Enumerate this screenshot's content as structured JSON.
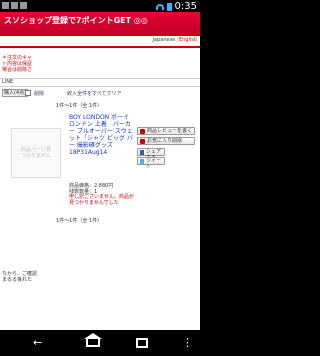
{
  "status_bar": {
    "time": "0:35"
  },
  "banner": {
    "text": "スソショップ登録で7ポイントGET ◎◎"
  },
  "language": {
    "japanese": "Japanese",
    "english": "English"
  },
  "notes": [
    "＊注文のキャ",
    "ト内容は保証",
    "場合は削除さ"
  ],
  "cart": {
    "header": "LINE",
    "add_button": "購入(4点)",
    "delete_label": "削除",
    "clear_label": "絞入全件をすべてクリア"
  },
  "count_label": "1件～1件（全 1件）",
  "item": {
    "thumb_text": "商品ページ見\nつかりません",
    "title": "BOY LONDON ボーイロンドン 上着　パーカー プルオーバー スウェット「シャツ ビッグ バー 撮影確グッズ 18P31Aug14",
    "price": "商品価格：2,880円",
    "stock": "残数数量：1",
    "message": "申し訳ございません。商品が見つかりませんでした"
  },
  "side_buttons": {
    "review": "商品レビューを書く",
    "favorite": "お気に入り削除",
    "facebook": "シェアする",
    "twitter": "ツイート"
  },
  "bottom_links": [
    "ちから、ご確認",
    "まるる良れた"
  ],
  "nav": {
    "back": "←",
    "menu": "⋮"
  }
}
